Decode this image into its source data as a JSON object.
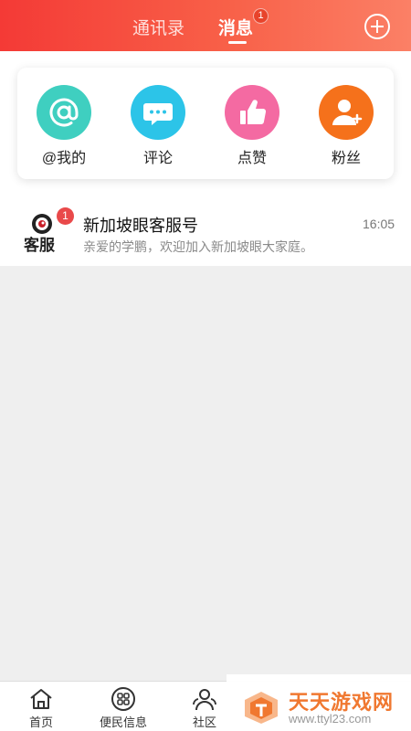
{
  "header": {
    "tabs": [
      {
        "label": "通讯录",
        "active": false
      },
      {
        "label": "消息",
        "active": true,
        "badge": "1"
      }
    ],
    "add_icon": "plus-circle-icon"
  },
  "actions": [
    {
      "label": "@我的",
      "icon": "at-icon",
      "color": "#3fcfc0"
    },
    {
      "label": "评论",
      "icon": "comment-bubble-icon",
      "color": "#2cc4e8"
    },
    {
      "label": "点赞",
      "icon": "thumbs-up-icon",
      "color": "#f46aa2"
    },
    {
      "label": "粉丝",
      "icon": "add-follower-icon",
      "color": "#f5711b"
    }
  ],
  "messages": [
    {
      "title": "新加坡眼客服号",
      "preview": "亲爱的学鹏，欢迎加入新加坡眼大家庭。",
      "time": "16:05",
      "badge": "1",
      "avatar_text": "客服"
    }
  ],
  "bottom_nav": [
    {
      "label": "首页",
      "icon": "home-icon"
    },
    {
      "label": "便民信息",
      "icon": "grid-icon"
    },
    {
      "label": "社区",
      "icon": "community-icon"
    }
  ],
  "watermark": {
    "title": "天天游戏网",
    "url": "www.ttyl23.com"
  }
}
